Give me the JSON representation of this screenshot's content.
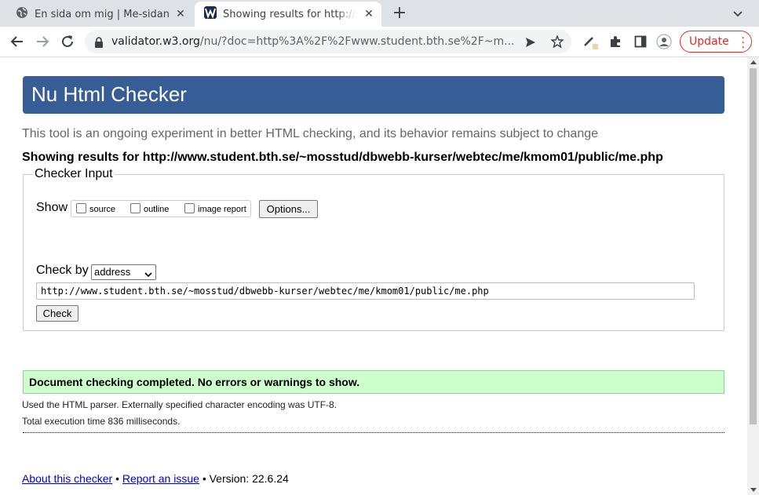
{
  "browser": {
    "tabs": [
      {
        "title": "En sida om mig | Me-sidan",
        "favicon": "globe-icon",
        "active": false
      },
      {
        "title": "Showing results for http://www.student.bth.se",
        "favicon": "w3c-icon",
        "active": true
      }
    ],
    "address": {
      "host": "validator.w3.org",
      "path": "/nu/?doc=http%3A%2F%2Fwww.student.bth.se%2F~m..."
    },
    "update_label": "Update",
    "accent_color": "#d93025"
  },
  "page": {
    "title": "Nu Html Checker",
    "subtitle": "This tool is an ongoing experiment in better HTML checking, and its behavior remains subject to change",
    "showing_results": "Showing results for http://www.student.bth.se/~mosstud/dbwebb-kurser/webtec/me/kmom01/public/me.php",
    "banner_color": "#365d95",
    "checker": {
      "legend": "Checker Input",
      "show_label": "Show",
      "show_options": [
        {
          "label": "source",
          "checked": false
        },
        {
          "label": "outline",
          "checked": false
        },
        {
          "label": "image report",
          "checked": false
        }
      ],
      "options_button": "Options...",
      "check_by_label": "Check by",
      "check_by_value": "address",
      "url_value": "http://www.student.bth.se/~mosstud/dbwebb-kurser/webtec/me/kmom01/public/me.php",
      "check_button": "Check"
    },
    "result": {
      "message": "Document checking completed. No errors or warnings to show.",
      "parser_note": "Used the HTML parser. Externally specified character encoding was UTF-8.",
      "execution_time": "Total execution time 836 milliseconds.",
      "success_color": "#ccffcc"
    },
    "footer": {
      "about_link": "About this checker",
      "bullet": "•",
      "report_link": "Report an issue",
      "version": "Version: 22.6.24"
    }
  }
}
